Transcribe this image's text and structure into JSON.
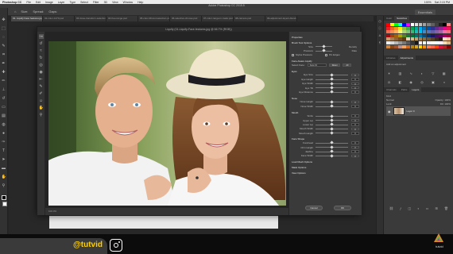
{
  "menubar": {
    "app_name": "Photoshop CC",
    "items": [
      "File",
      "Edit",
      "Image",
      "Layer",
      "Type",
      "Select",
      "Filter",
      "3D",
      "View",
      "Window",
      "Help"
    ],
    "right_items": [
      "100%",
      "Sat 2:15 PM"
    ]
  },
  "window_title": "Adobe Photoshop CC 2015.5",
  "options_bar": {
    "items": [
      "Size:",
      "Spread:",
      "Gaps:"
    ],
    "workspace": "Essentials"
  },
  "doc_tabs": [
    {
      "label": "01. Liquify Face features.jpg @ 66.7% (Layer 0, RGB/8)",
      "active": true
    },
    {
      "label": "02-color-1470.psd",
      "active": false
    },
    {
      "label": "03 close-transform-selection.psd",
      "active": false
    },
    {
      "label": "04-free-range.psd",
      "active": false
    },
    {
      "label": "05-color-fill-tool-selection.psd",
      "active": false
    },
    {
      "label": "06-selective-choose.psd",
      "active": false
    },
    {
      "label": "07-color-range-in-mask.psd",
      "active": false
    },
    {
      "label": "08-camera.psd",
      "active": false
    },
    {
      "label": "09-adjustment-layers-blend-mode.psd",
      "active": false
    }
  ],
  "dialog": {
    "title": "Liquify (01-Liquify-Face-features.jpg @ 66.7% (RGB))",
    "status": {
      "zoom": "100.0%",
      "mode": "Pin Edges"
    },
    "properties": {
      "heading": "Properties",
      "brush_section": "Brush Tool Options",
      "brush_rows": [
        {
          "label": "Size",
          "value": "",
          "label2": "Density"
        },
        {
          "label": "Pressure",
          "value": "",
          "label2": "Rate"
        }
      ],
      "stylus": "Stylus Pressure",
      "pin_edges": "Pin Edges",
      "face_section": "Face-Aware Liquify",
      "select_face_label": "Select Face:",
      "select_face_value": "Face #1",
      "reset_label": "Reset",
      "all_label": "All",
      "eyes_section": "Eyes",
      "eye_rows": [
        {
          "label": "Eye Size",
          "value": "0"
        },
        {
          "label": "Eye Height",
          "value": "0"
        },
        {
          "label": "Eye Width",
          "value": "0"
        },
        {
          "label": "Eye Tilt",
          "value": "0"
        },
        {
          "label": "Eye Distance",
          "value": "0"
        }
      ],
      "nose_section": "Nose",
      "nose_rows": [
        {
          "label": "Nose Height",
          "value": "0"
        },
        {
          "label": "Nose Width",
          "value": "0"
        }
      ],
      "mouth_section": "Mouth",
      "mouth_rows": [
        {
          "label": "Smile",
          "value": "0"
        },
        {
          "label": "Upper Lip",
          "value": "0"
        },
        {
          "label": "Lower Lip",
          "value": "0"
        },
        {
          "label": "Mouth Width",
          "value": "0"
        },
        {
          "label": "Mouth Height",
          "value": "0"
        }
      ],
      "face_shape_section": "Face Shape",
      "face_shape_rows": [
        {
          "label": "Forehead",
          "value": "0"
        },
        {
          "label": "Chin Height",
          "value": "0"
        },
        {
          "label": "Jawline",
          "value": "0"
        },
        {
          "label": "Face Width",
          "value": "0"
        }
      ],
      "load_mesh": "Load Mesh Options",
      "mask_options": "Mask Options",
      "view_options": "View Options",
      "cancel_label": "Cancel",
      "ok_label": "OK"
    }
  },
  "right_panel": {
    "top_tabs": [
      "Color",
      "Swatches"
    ],
    "swatch_colors": [
      "#ff0000",
      "#ffff00",
      "#00ff00",
      "#00ffff",
      "#0000ff",
      "#ff00ff",
      "#ffffff",
      "#e0e0e0",
      "#c0c0c0",
      "#a0a0a0",
      "#808080",
      "#606060",
      "#404040",
      "#202020",
      "#000000",
      "#ff8080",
      "#ee1c24",
      "#f26522",
      "#f7941d",
      "#fff200",
      "#8dc63f",
      "#39b54a",
      "#00a651",
      "#00a99d",
      "#00aeef",
      "#0072bc",
      "#0054a6",
      "#2e3192",
      "#662d91",
      "#92278f",
      "#ec008c",
      "#ed145b",
      "#f26c4f",
      "#f68e55",
      "#fbaf5c",
      "#fff467",
      "#acd372",
      "#7cc576",
      "#3bb878",
      "#1abbb4",
      "#00bff3",
      "#438ccb",
      "#5574b9",
      "#605ca8",
      "#8560a8",
      "#a863a8",
      "#f06eaa",
      "#f26d7d",
      "#9e0b0f",
      "#a0410d",
      "#a36209",
      "#aba000",
      "#598527",
      "#1a7b30",
      "#007236",
      "#00746b",
      "#0076a3",
      "#004b80",
      "#003471",
      "#1b1464",
      "#440e62",
      "#630460",
      "#9e005d",
      "#9e0039",
      "#c69c6d",
      "#a67c52",
      "#8c6239",
      "#754c24",
      "#603913",
      "#e8d3b6",
      "#d6b98c",
      "#c2a06a",
      "#a57f4f",
      "#8b6a3e",
      "#715632",
      "#574228",
      "#3d2e1c",
      "#241b10",
      "#ffe0c0",
      "#ffc8a0",
      "#f0f0f0",
      "#d8d8d8",
      "#b8b8b8",
      "#989898",
      "#787878",
      "#585858",
      "#383838",
      "#181818",
      "#ffeeee",
      "#eeffee",
      "#eeeeff",
      "#ffffee",
      "#eeffff",
      "#ffeeff",
      "#f5deb3",
      "#deb887",
      "#cd853f",
      "#8b4513",
      "#a0522d",
      "#bc8f8f",
      "#f4a460",
      "#d2691e",
      "#b8860b",
      "#daa520",
      "#ffd700",
      "#ff8c00",
      "#ff7f50",
      "#ff6347",
      "#ff4500",
      "#dc143c",
      "#b22222",
      "#8b0000"
    ],
    "adjust_title": "Add an adjustment",
    "mid_tabs": [
      "Libraries",
      "Adjustments"
    ],
    "layers_tabs": [
      "Channels",
      "Paths",
      "Layers"
    ],
    "kind_label": "Kind",
    "blend_mode": "Normal",
    "opacity_label": "Opacity: 100%",
    "lock_label": "Lock:",
    "fill_label": "Fill: 100%",
    "layer_name": "Layer 0"
  },
  "overlay": {
    "handle": "@tutvid",
    "brand": "tutvid"
  }
}
